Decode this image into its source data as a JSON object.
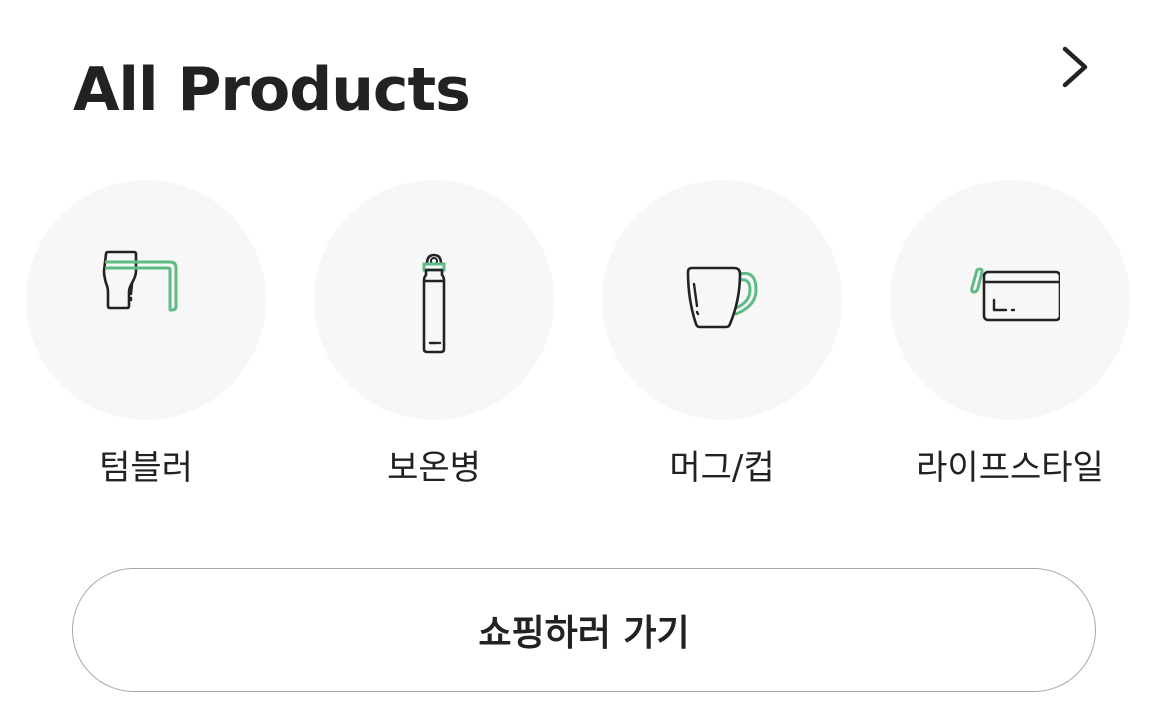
{
  "header": {
    "title": "All Products",
    "more_icon": "chevron-right-icon"
  },
  "colors": {
    "accent": "#5fbb86",
    "text": "#222222",
    "circle_bg": "#f7f7f7",
    "button_border": "#a8a8a8"
  },
  "categories": [
    {
      "label": "텀블러",
      "icon": "tumbler-icon"
    },
    {
      "label": "보온병",
      "icon": "thermos-bottle-icon"
    },
    {
      "label": "머그/컵",
      "icon": "mug-icon"
    },
    {
      "label": "라이프스타일",
      "icon": "pouch-icon"
    }
  ],
  "shop_button": {
    "label": "쇼핑하러 가기"
  }
}
